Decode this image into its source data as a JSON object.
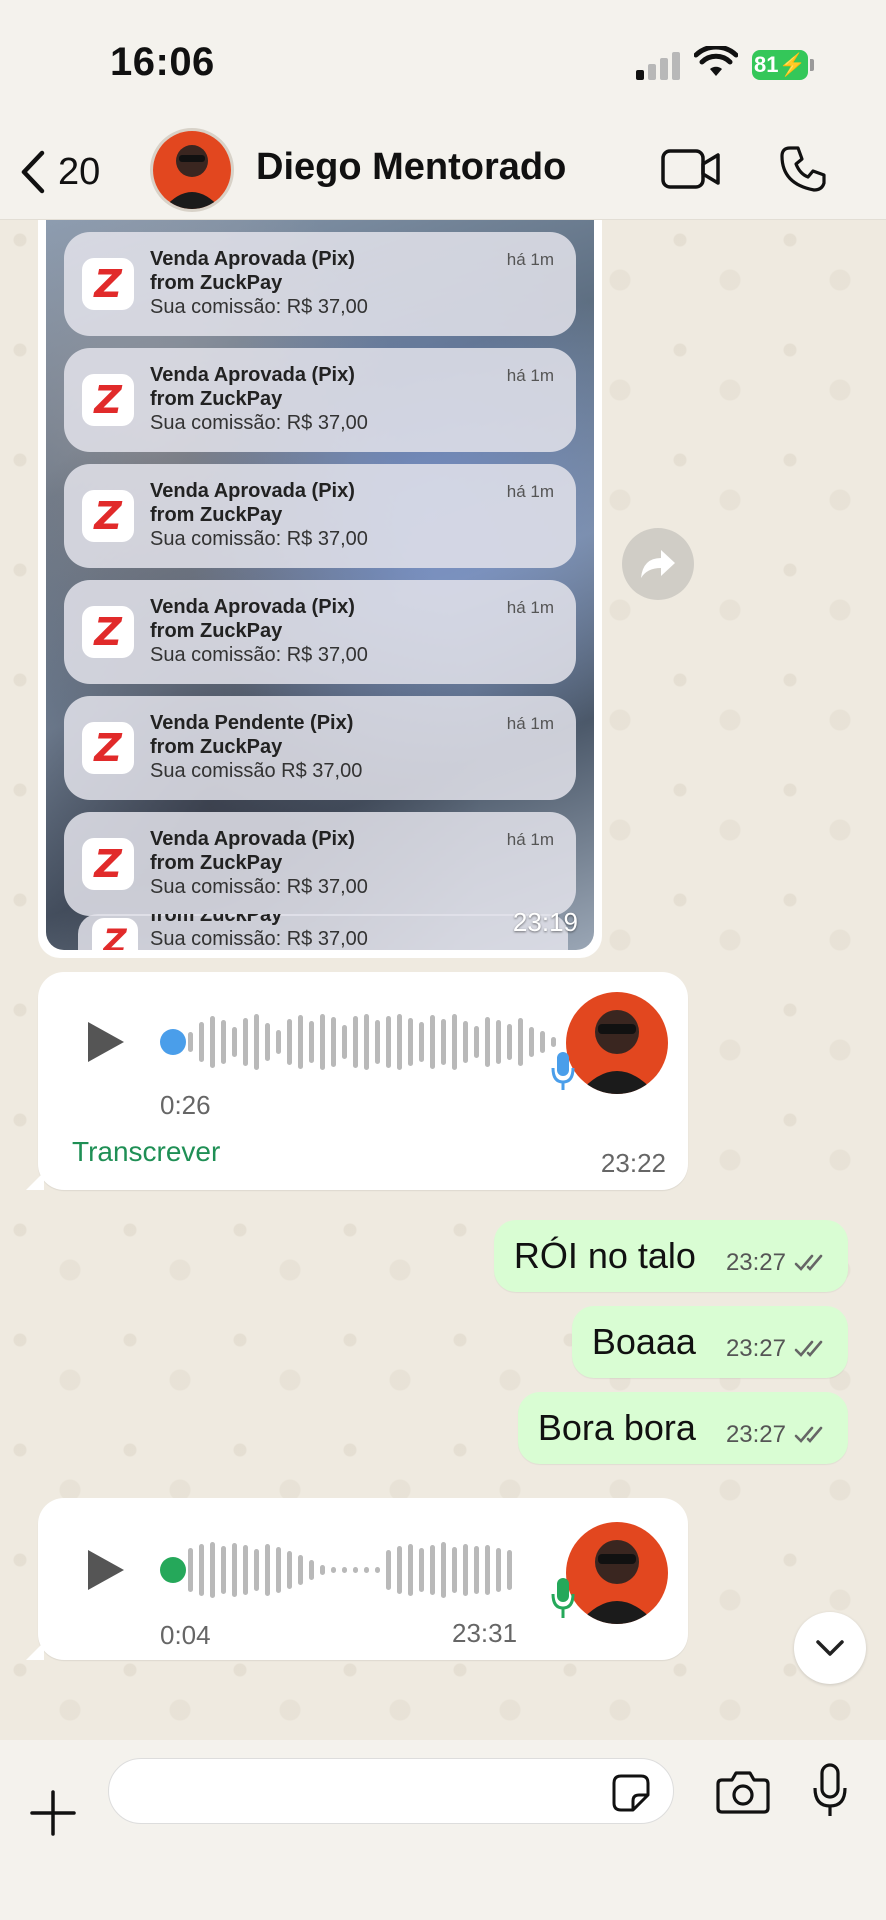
{
  "status_bar": {
    "time": "16:06",
    "battery": "81"
  },
  "header": {
    "back_count": "20",
    "contact_name": "Diego Mentorado"
  },
  "image_message": {
    "notifications": [
      {
        "title": "Venda Aprovada (Pix)",
        "from": "from ZuckPay",
        "body": "Sua comissão: R$ 37,00",
        "time": "há 1m"
      },
      {
        "title": "Venda Aprovada (Pix)",
        "from": "from ZuckPay",
        "body": "Sua comissão: R$ 37,00",
        "time": "há 1m"
      },
      {
        "title": "Venda Aprovada (Pix)",
        "from": "from ZuckPay",
        "body": "Sua comissão: R$ 37,00",
        "time": "há 1m"
      },
      {
        "title": "Venda Aprovada (Pix)",
        "from": "from ZuckPay",
        "body": "Sua comissão: R$ 37,00",
        "time": "há 1m"
      },
      {
        "title": "Venda Pendente (Pix)",
        "from": "from ZuckPay",
        "body": "Sua comissão R$ 37,00",
        "time": "há 1m"
      },
      {
        "title": "Venda Aprovada (Pix)",
        "from": "from ZuckPay",
        "body": "Sua comissão: R$ 37,00",
        "time": "há 1m"
      }
    ],
    "partial": {
      "from": "from ZuckPay",
      "body": "Sua comissão: R$ 37,00"
    },
    "time": "23:19"
  },
  "audio_1": {
    "duration": "0:26",
    "transcribe": "Transcrever",
    "time": "23:22",
    "mic_color": "#4a9eea",
    "dot_color": "#4a9eea"
  },
  "outgoing": [
    {
      "text": "RÓI no talo",
      "time": "23:27"
    },
    {
      "text": "Boaaa",
      "time": "23:27"
    },
    {
      "text": "Bora bora",
      "time": "23:27"
    }
  ],
  "audio_2": {
    "duration": "0:04",
    "time": "23:31",
    "mic_color": "#25a85a",
    "dot_color": "#25a85a"
  },
  "colors": {
    "accent_green": "#1f8f55",
    "outgoing_bubble": "#d9fdd3",
    "battery": "#34c759"
  },
  "icons": [
    "chevron-left-icon",
    "video-icon",
    "phone-icon",
    "forward-icon",
    "play-icon",
    "mic-icon",
    "chevron-down-icon",
    "plus-icon",
    "sticker-icon",
    "camera-icon"
  ]
}
